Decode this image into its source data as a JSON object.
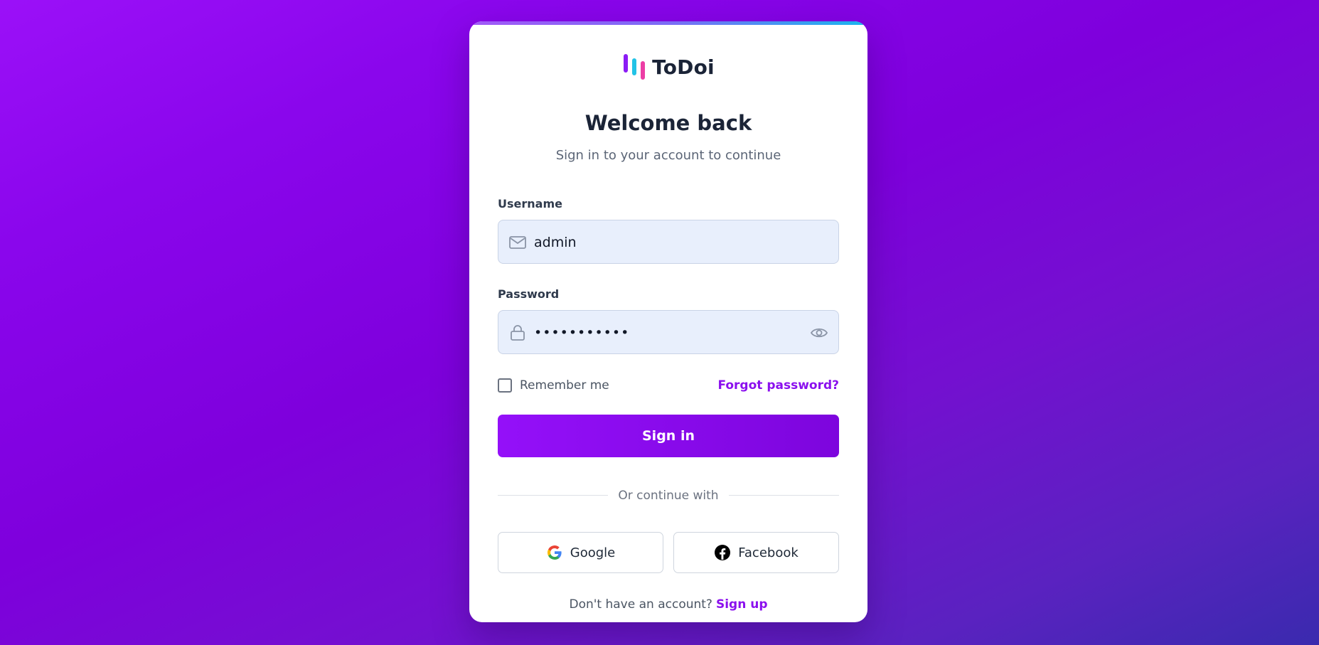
{
  "brand": {
    "name": "ToDoi"
  },
  "header": {
    "title": "Welcome back",
    "subtitle": "Sign in to your account to continue"
  },
  "form": {
    "username": {
      "label": "Username",
      "value": "admin",
      "icon": "mail-icon"
    },
    "password": {
      "label": "Password",
      "value": "•••••••••••",
      "icon": "lock-icon",
      "toggle_icon": "eye-icon"
    },
    "remember": {
      "label": "Remember me",
      "checked": false
    },
    "forgot_label": "Forgot password?",
    "submit_label": "Sign in"
  },
  "divider": {
    "text": "Or continue with"
  },
  "social": {
    "google": {
      "label": "Google",
      "icon": "google-icon"
    },
    "facebook": {
      "label": "Facebook",
      "icon": "facebook-icon"
    }
  },
  "footer": {
    "prompt": "Don't have an account?",
    "signup_label": "Sign up"
  },
  "colors": {
    "accent": "#8b10ee",
    "background_start": "#9b10f8",
    "background_end": "#3a2aae",
    "input_bg": "#e8effc",
    "text_dark": "#1b2437"
  }
}
